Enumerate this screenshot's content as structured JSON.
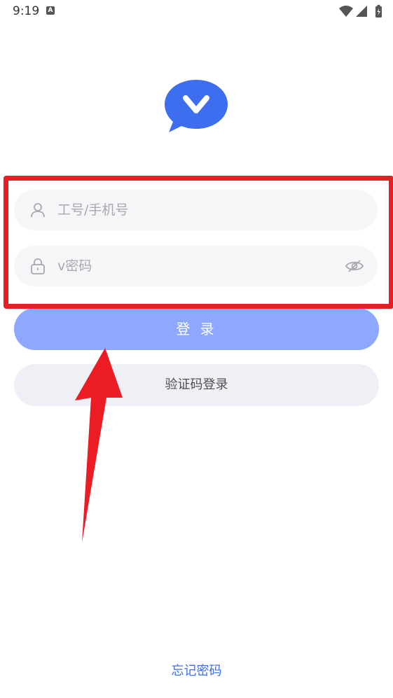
{
  "status_bar": {
    "time": "9:19",
    "notification_letter": "A"
  },
  "login": {
    "username_placeholder": "工号/手机号",
    "password_placeholder": "v密码",
    "login_label": "登 录",
    "code_login_label": "验证码登录",
    "forgot_password": "忘记密码"
  },
  "icons": [
    "app-logo-icon",
    "user-icon",
    "lock-icon",
    "eye-off-icon",
    "wifi-icon",
    "signal-icon",
    "battery-icon"
  ],
  "colors": {
    "primary": "#8ea8fd",
    "logo": "#3d6ef0",
    "link": "#3d6ef0",
    "annotation": "#ec1c24"
  }
}
